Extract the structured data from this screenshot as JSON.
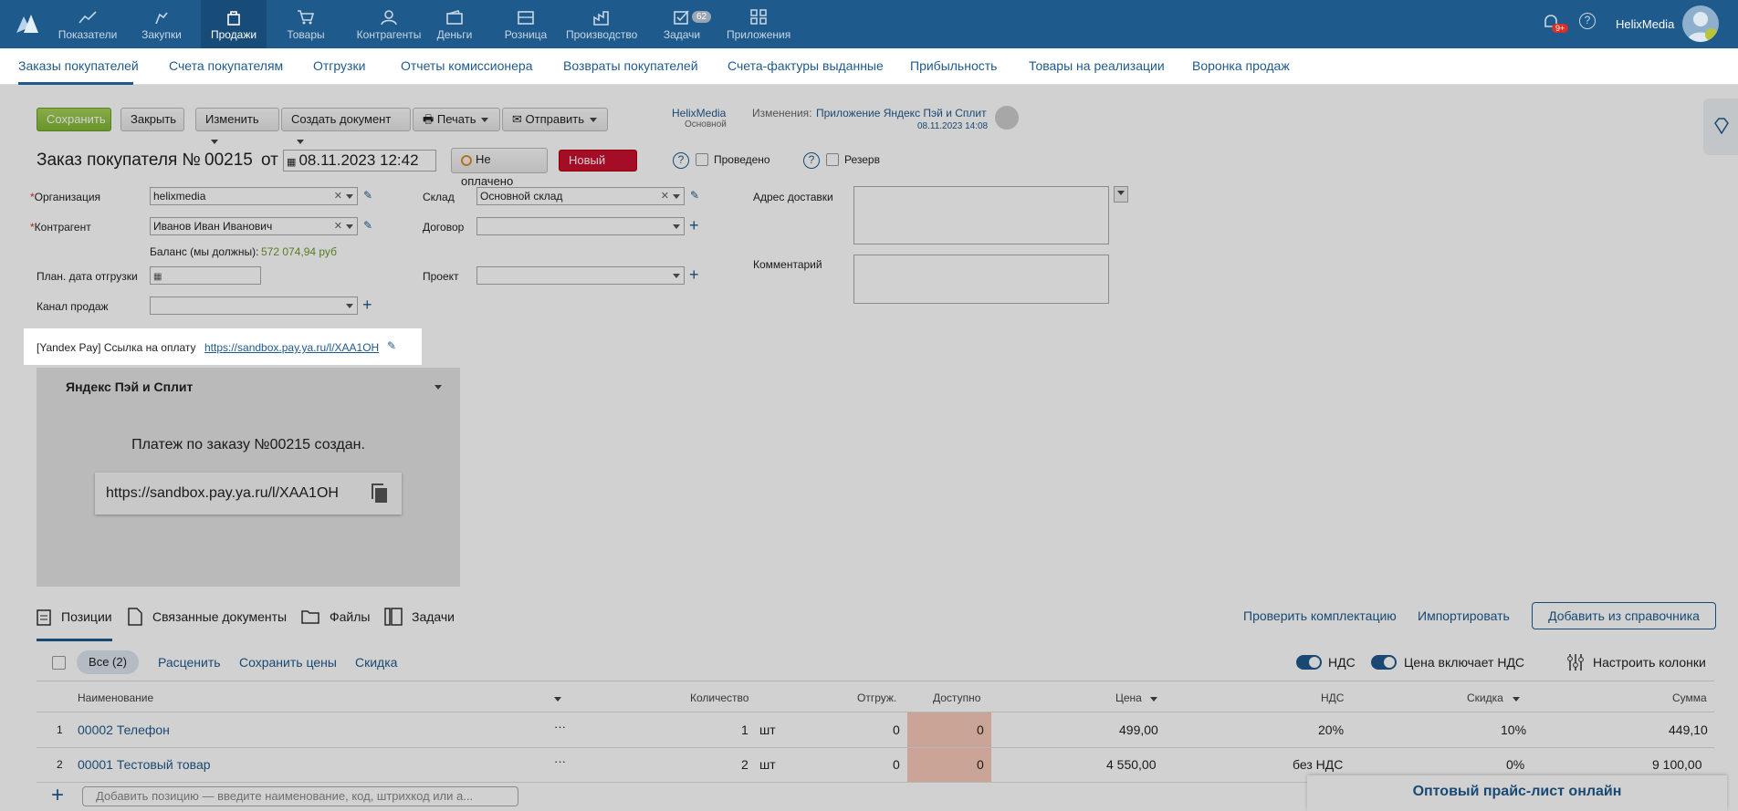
{
  "topnav": {
    "items": [
      "Показатели",
      "Закупки",
      "Продажи",
      "Товары",
      "Контрагенты",
      "Деньги",
      "Розница",
      "Производство",
      "Задачи",
      "Приложения"
    ],
    "tasks_badge": "62",
    "notifications_badge": "9+",
    "user": "HelixMedia"
  },
  "subnav": {
    "tabs": [
      "Заказы покупателей",
      "Счета покупателям",
      "Отгрузки",
      "Отчеты комиссионера",
      "Возвраты покупателей",
      "Счета-фактуры выданные",
      "Прибыльность",
      "Товары на реализации",
      "Воронка продаж"
    ]
  },
  "toolbar": {
    "save": "Сохранить",
    "close": "Закрыть",
    "edit": "Изменить",
    "create_doc": "Создать документ",
    "print": "Печать",
    "send": "Отправить"
  },
  "meta": {
    "org_name": "HelixMedia",
    "org_sub": "Основной",
    "changes_label": "Изменения:",
    "changes_value": "Приложение Яндекс Пэй и Сплит",
    "changes_date": "08.11.2023 14:08"
  },
  "order": {
    "title": "Заказ покупателя №",
    "number": "00215",
    "from": "от",
    "date": "08.11.2023 12:42",
    "payment_status": "Не оплачено",
    "status": "Новый",
    "posted": "Проведено",
    "reserve": "Резерв"
  },
  "form": {
    "org_label": "Организация",
    "org_value": "helixmedia",
    "counterparty_label": "Контрагент",
    "counterparty_value": "Иванов Иван Иванович",
    "balance_label": "Баланс (мы должны):",
    "balance_value": "572 074,94 руб",
    "ship_date_label": "План. дата отгрузки",
    "channel_label": "Канал продаж",
    "warehouse_label": "Склад",
    "warehouse_value": "Основной склад",
    "contract_label": "Договор",
    "project_label": "Проект",
    "address_label": "Адрес доставки",
    "comment_label": "Комментарий"
  },
  "yandex": {
    "link_label": "[Yandex Pay] Ссылка на оплату",
    "link_url": "https://sandbox.pay.ya.ru/l/XAA1OH",
    "panel_title": "Яндекс Пэй и Сплит",
    "created_msg": "Платеж по заказу №00215 создан.",
    "copy_url": "https://sandbox.pay.ya.ru/l/XAA1OH"
  },
  "bottom_tabs": {
    "positions": "Позиции",
    "related": "Связанные документы",
    "files": "Файлы",
    "tasks": "Задачи",
    "check": "Проверить комплектацию",
    "import": "Импортировать",
    "add_from_catalog": "Добавить из справочника"
  },
  "table_toolbar": {
    "all": "Все (2)",
    "reprice": "Расценить",
    "save_prices": "Сохранить цены",
    "discount": "Скидка",
    "vat": "НДС",
    "price_includes_vat": "Цена включает НДС",
    "columns": "Настроить колонки"
  },
  "table": {
    "headers": [
      "Наименование",
      "Количество",
      "Отгруж.",
      "Доступно",
      "Цена",
      "НДС",
      "Скидка",
      "Сумма"
    ],
    "rows": [
      {
        "n": "1",
        "name": "00002 Телефон",
        "qty": "1",
        "unit": "шт",
        "shipped": "0",
        "available": "0",
        "price": "499,00",
        "vat": "20%",
        "discount": "10%",
        "sum": "449,10"
      },
      {
        "n": "2",
        "name": "00001 Тестовый товар",
        "qty": "2",
        "unit": "шт",
        "shipped": "0",
        "available": "0",
        "price": "4 550,00",
        "vat": "без НДС",
        "discount": "0%",
        "sum": "9 100,00"
      }
    ],
    "add_placeholder": "Добавить позицию — введите наименование, код, штрихкод или а..."
  },
  "promo": "Оптовый прайс-лист онлайн"
}
